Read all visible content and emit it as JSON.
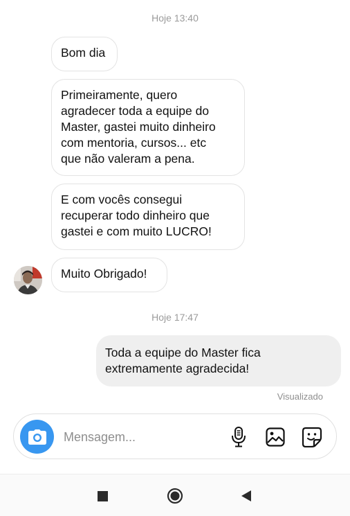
{
  "conversation": {
    "timestamp_1": "Hoje 13:40",
    "incoming": [
      {
        "lines": [
          "Bom dia"
        ]
      },
      {
        "lines": [
          "Primeiramente, quero",
          "agradecer toda a equipe do",
          "Master, gastei muito dinheiro",
          "com mentoria, cursos... etc",
          "que não valeram a pena."
        ]
      },
      {
        "lines": [
          "E com vocês consegui",
          "recuperar todo dinheiro que",
          "gastei e com muito LUCRO!"
        ]
      },
      {
        "lines": [
          "Muito Obrigado!"
        ]
      }
    ],
    "timestamp_2": "Hoje 17:47",
    "outgoing": [
      {
        "lines": [
          "Toda a equipe do Master fica",
          "extremamente agradecida!"
        ]
      }
    ],
    "seen_status": "Visualizado"
  },
  "composer": {
    "placeholder": "Mensagem...",
    "camera_icon": "camera-icon",
    "mic_icon": "microphone-icon",
    "gallery_icon": "image-icon",
    "sticker_icon": "sticker-icon"
  },
  "navbar": {
    "icons": [
      "square-icon",
      "circle-home-icon",
      "back-triangle-icon"
    ]
  },
  "colors": {
    "accent": "#3897f0",
    "outgoing_bubble": "#efefef",
    "incoming_border": "#e3e3e3",
    "muted_text": "#9a9a9a"
  }
}
